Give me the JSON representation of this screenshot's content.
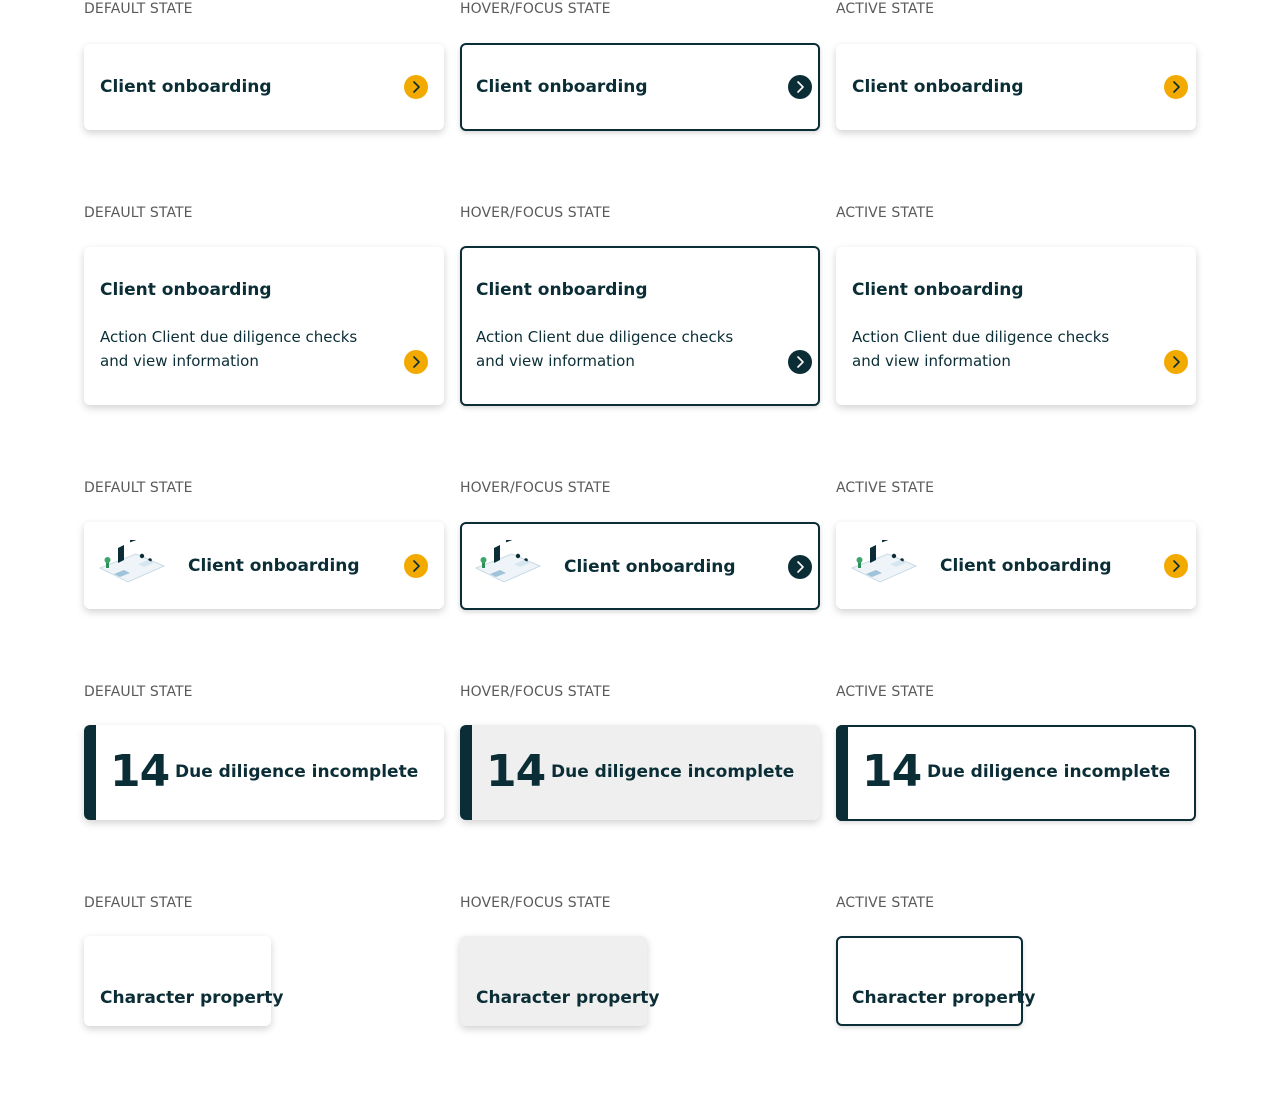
{
  "states": {
    "default": "DEFAULT STATE",
    "hover": "HOVER/FOCUS STATE",
    "active": "ACTIVE STATE"
  },
  "card_title": "Client onboarding",
  "card_description": "Action Client due diligence checks and view information",
  "stat": {
    "number": "14",
    "label": "Due diligence incomplete"
  },
  "tile_label": "Character property",
  "icons": {
    "arrow": "chevron-right-icon",
    "illustration": "desk-illustration"
  },
  "colors": {
    "accent": "#f2a900",
    "primary": "#0b2e36",
    "hover_bg": "#efefef",
    "label": "#5a5a5a"
  }
}
